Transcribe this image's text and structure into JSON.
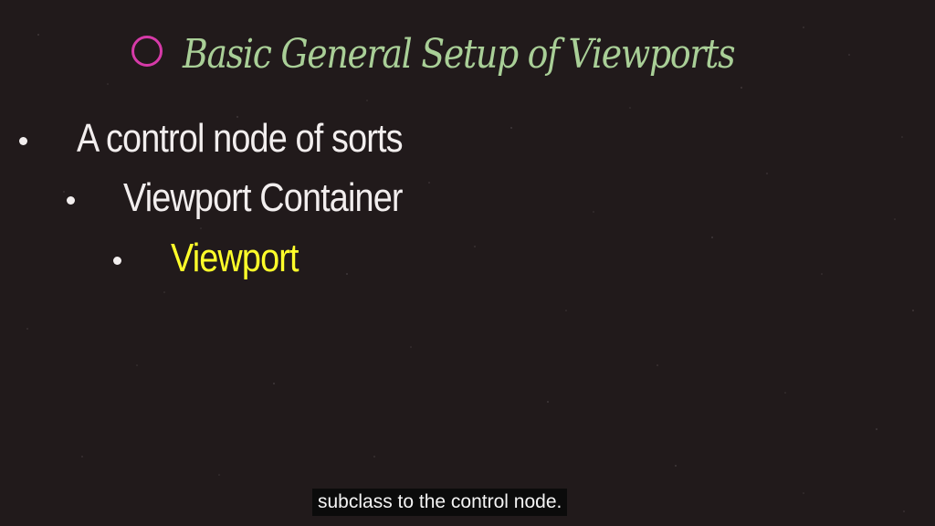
{
  "slide": {
    "title": "Basic General Setup of Viewports",
    "title_marker_icon": "circle-outline-icon",
    "bullets": [
      {
        "text": "A control node of sorts",
        "level": 1
      },
      {
        "text": "Viewport Container",
        "level": 2
      },
      {
        "text": "Viewport",
        "level": 3
      }
    ]
  },
  "caption": {
    "text": "subclass to the control node."
  },
  "colors": {
    "background": "#211a1b",
    "title": "#a9cf97",
    "title_marker": "#d63aa8",
    "bullet_text": "#f2eeee",
    "highlight_text": "#ffff2a",
    "caption_background": "#0b0b0b"
  }
}
